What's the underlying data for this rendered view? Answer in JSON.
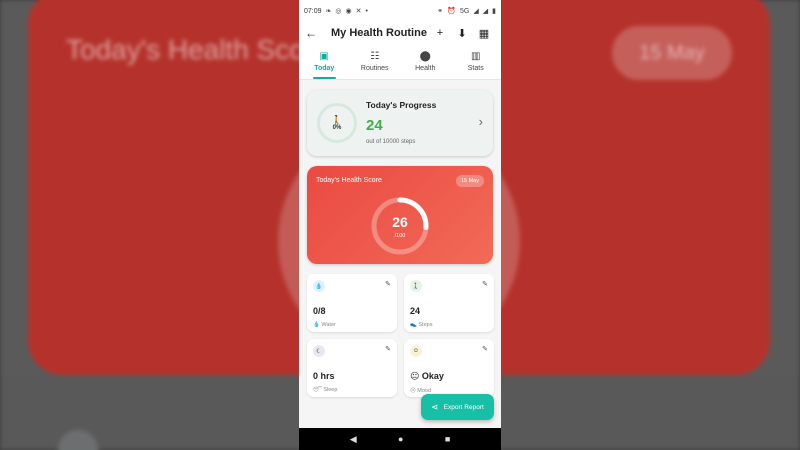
{
  "background": {
    "title": "Today's Health Score",
    "date": "15 May"
  },
  "status_bar": {
    "time": "07:09",
    "signal": "5G"
  },
  "app_bar": {
    "title": "My Health Routine",
    "back_icon": "←",
    "add_icon": "+",
    "export_icon": "⬇",
    "calendar_icon": "▦"
  },
  "tabs": [
    {
      "label": "Today",
      "icon": "▣"
    },
    {
      "label": "Routines",
      "icon": "☷"
    },
    {
      "label": "Health",
      "icon": "⬤"
    },
    {
      "label": "Stats",
      "icon": "▥"
    }
  ],
  "progress": {
    "title": "Today's Progress",
    "percent": "0%",
    "value": "24",
    "subtitle": "out of 10000 steps"
  },
  "health_score": {
    "title": "Today's Health Score",
    "date": "15 May",
    "score": "26",
    "max": "/100",
    "fraction": 0.26
  },
  "stats": [
    {
      "value": "0/8",
      "label": "💧 Water",
      "icon": "💧",
      "icon_bg": "#e3f0fb"
    },
    {
      "value": "24",
      "label": "👟 Steps",
      "icon": "🚶",
      "icon_bg": "#e6f4e8"
    },
    {
      "value": "0 hrs",
      "label": "😴 Sleep",
      "icon": "☾",
      "icon_bg": "#e6e8f6"
    },
    {
      "value": "😐 Okay",
      "label": "😐 Mood",
      "icon": "☺",
      "icon_bg": "#fbf1d6"
    }
  ],
  "fab": {
    "label": "Export Report",
    "icon": "⋖"
  },
  "colors": {
    "accent": "#17a99a",
    "score_card": "#ea4a42",
    "progress_value": "#3fae4a"
  }
}
